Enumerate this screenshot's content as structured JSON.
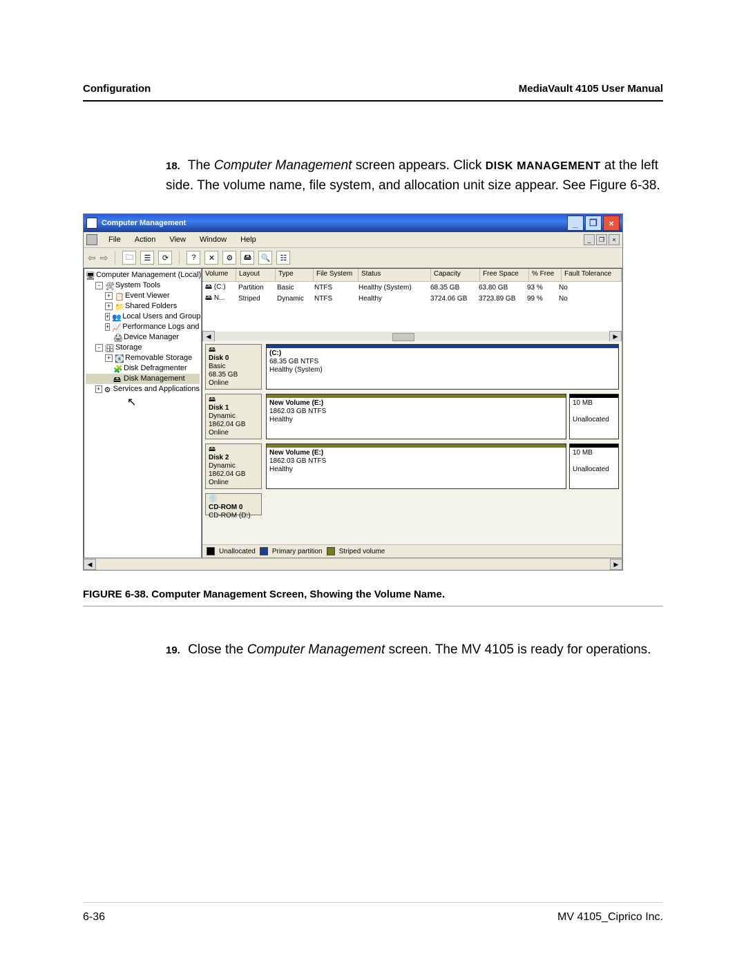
{
  "header": {
    "left": "Configuration",
    "right": "MediaVault 4105 User Manual"
  },
  "step18": {
    "num": "18.",
    "a": "The ",
    "em1": "Computer Management",
    "b": " screen appears. Click ",
    "sc1": "Disk",
    "c": " ",
    "sc2": "Management",
    "d": " at the left side. The volume name, file system, and allocation unit size appear. See Figure 6-38."
  },
  "step19": {
    "num": "19.",
    "a": "Close the ",
    "em1": "Computer Management",
    "b": " screen. The MV 4105 is ready for operations."
  },
  "caption": "FIGURE 6-38. Computer Management Screen, Showing the Volume Name.",
  "footer": {
    "left": "6-36",
    "right": "MV 4105_Ciprico Inc."
  },
  "win": {
    "title": "Computer Management",
    "menu": {
      "file": "File",
      "action": "Action",
      "view": "View",
      "window": "Window",
      "help": "Help"
    },
    "tree": {
      "root": "Computer Management (Local)",
      "systools": "System Tools",
      "ev": "Event Viewer",
      "sf": "Shared Folders",
      "lug": "Local Users and Groups",
      "pla": "Performance Logs and Alerts",
      "dm": "Device Manager",
      "storage": "Storage",
      "rs": "Removable Storage",
      "dd": "Disk Defragmenter",
      "dmgmt": "Disk Management",
      "sa": "Services and Applications"
    },
    "cols": {
      "vol": "Volume",
      "lay": "Layout",
      "typ": "Type",
      "fs": "File System",
      "sta": "Status",
      "cap": "Capacity",
      "fsp": "Free Space",
      "pf": "% Free",
      "ft": "Fault Tolerance"
    },
    "vols": [
      {
        "vol": "(C:)",
        "lay": "Partition",
        "typ": "Basic",
        "fs": "NTFS",
        "sta": "Healthy (System)",
        "cap": "68.35 GB",
        "fsp": "63.80 GB",
        "pf": "93 %",
        "ft": "No"
      },
      {
        "vol": "N...",
        "lay": "Striped",
        "typ": "Dynamic",
        "fs": "NTFS",
        "sta": "Healthy",
        "cap": "3724.06 GB",
        "fsp": "3723.89 GB",
        "pf": "99 %",
        "ft": "No"
      }
    ],
    "disks": {
      "d0": {
        "name": "Disk 0",
        "t1": "Basic",
        "t2": "68.35 GB",
        "t3": "Online",
        "p_title": "(C:)",
        "p_l2": "68.35 GB NTFS",
        "p_l3": "Healthy (System)"
      },
      "d1": {
        "name": "Disk 1",
        "t1": "Dynamic",
        "t2": "1862.04 GB",
        "t3": "Online",
        "p_title": "New Volume  (E:)",
        "p_l2": "1862.03 GB NTFS",
        "p_l3": "Healthy",
        "u1": "10 MB",
        "u2": "Unallocated"
      },
      "d2": {
        "name": "Disk 2",
        "t1": "Dynamic",
        "t2": "1862.04 GB",
        "t3": "Online",
        "p_title": "New Volume  (E:)",
        "p_l2": "1862.03 GB NTFS",
        "p_l3": "Healthy",
        "u1": "10 MB",
        "u2": "Unallocated"
      },
      "cd": {
        "name": "CD-ROM 0",
        "t1": "CD-ROM (D:)"
      }
    },
    "legend": {
      "un": "Unallocated",
      "pp": "Primary partition",
      "sv": "Striped volume"
    }
  }
}
